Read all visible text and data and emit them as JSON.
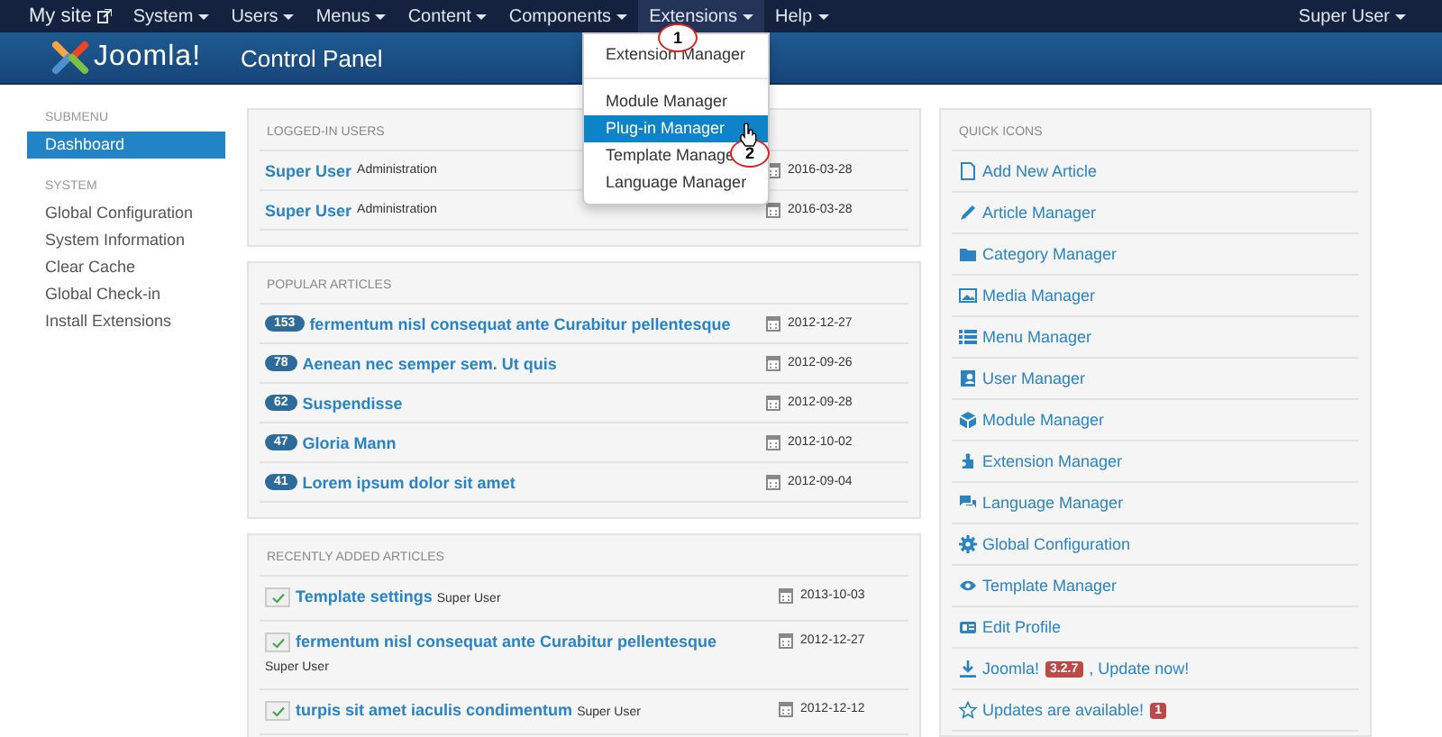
{
  "site_link": {
    "label": "My site"
  },
  "menu": [
    {
      "label": "System",
      "open": false
    },
    {
      "label": "Users",
      "open": false
    },
    {
      "label": "Menus",
      "open": false
    },
    {
      "label": "Content",
      "open": false
    },
    {
      "label": "Components",
      "open": false
    },
    {
      "label": "Extensions",
      "open": true
    },
    {
      "label": "Help",
      "open": false
    }
  ],
  "user_menu": {
    "label": "Super User"
  },
  "header": {
    "logo": "Joomla!",
    "title": "Control Panel"
  },
  "dropdown": {
    "items": [
      {
        "label": "Extension Manager",
        "selected": false,
        "divider_after": true
      },
      {
        "label": "Module Manager",
        "selected": false,
        "divider_after": false
      },
      {
        "label": "Plug-in Manager",
        "selected": true,
        "divider_after": false
      },
      {
        "label": "Template Manage",
        "selected": false,
        "divider_after": false
      },
      {
        "label": "Language Manager",
        "selected": false,
        "divider_after": false
      }
    ]
  },
  "annotations": [
    {
      "label": "1"
    },
    {
      "label": "2"
    }
  ],
  "sidebar": {
    "sections": [
      {
        "heading": "SUBMENU",
        "items": [
          {
            "label": "Dashboard",
            "selected": true
          }
        ]
      },
      {
        "heading": "SYSTEM",
        "items": [
          {
            "label": "Global Configuration",
            "selected": false
          },
          {
            "label": "System Information",
            "selected": false
          },
          {
            "label": "Clear Cache",
            "selected": false
          },
          {
            "label": "Global Check-in",
            "selected": false
          },
          {
            "label": "Install Extensions",
            "selected": false
          }
        ]
      }
    ]
  },
  "panels": [
    {
      "title": "LOGGED-IN USERS",
      "kind": "users",
      "rows": [
        {
          "name": "Super User",
          "role": "Administration",
          "date": "2016-03-28"
        },
        {
          "name": "Super User",
          "role": "Administration",
          "date": "2016-03-28"
        }
      ]
    },
    {
      "title": "POPULAR ARTICLES",
      "kind": "popular",
      "rows": [
        {
          "hits": "153",
          "title": "fermentum nisl consequat ante Curabitur pellentesque",
          "date": "2012-12-27"
        },
        {
          "hits": "78",
          "title": "Aenean nec semper sem. Ut quis",
          "date": "2012-09-26"
        },
        {
          "hits": "62",
          "title": "Suspendisse",
          "date": "2012-09-28"
        },
        {
          "hits": "47",
          "title": "Gloria Mann",
          "date": "2012-10-02"
        },
        {
          "hits": "41",
          "title": "Lorem ipsum dolor sit amet",
          "date": "2012-09-04"
        }
      ]
    },
    {
      "title": "RECENTLY ADDED ARTICLES",
      "kind": "recent",
      "rows": [
        {
          "title": "Template settings",
          "author": "Super User",
          "date": "2013-10-03",
          "published": true
        },
        {
          "title": "fermentum nisl consequat ante Curabitur pellentesque",
          "author": "Super User",
          "date": "2012-12-27",
          "published": true
        },
        {
          "title": "turpis sit amet iaculis condimentum",
          "author": "Super User",
          "date": "2012-12-12",
          "published": true
        }
      ]
    }
  ],
  "quick_icons": {
    "title": "QUICK ICONS",
    "items": [
      {
        "kind": "file",
        "label": "Add New Article"
      },
      {
        "kind": "pencil",
        "label": "Article Manager"
      },
      {
        "kind": "folder",
        "label": "Category Manager"
      },
      {
        "kind": "image",
        "label": "Media Manager"
      },
      {
        "kind": "list",
        "label": "Menu Manager"
      },
      {
        "kind": "user",
        "label": "User Manager"
      },
      {
        "kind": "cube",
        "label": "Module Manager"
      },
      {
        "kind": "puzzle",
        "label": "Extension Manager"
      },
      {
        "kind": "comments",
        "label": "Language Manager"
      },
      {
        "kind": "cog",
        "label": "Global Configuration"
      },
      {
        "kind": "eye",
        "label": "Template Manager"
      },
      {
        "kind": "card",
        "label": "Edit Profile"
      },
      {
        "kind": "download",
        "label": "Joomla!",
        "badge": "3.2.7",
        "suffix": ", Update now!"
      },
      {
        "kind": "star",
        "label": "Updates are available!",
        "badge": "1"
      }
    ]
  }
}
